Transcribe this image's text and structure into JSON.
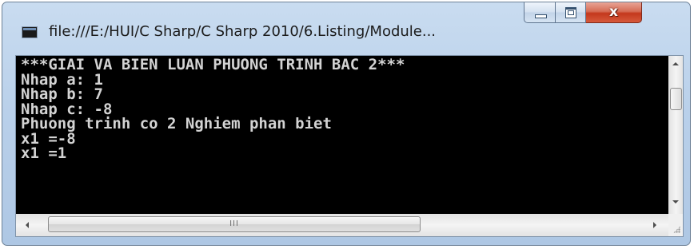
{
  "window": {
    "title": "file:///E:/HUI/C Sharp/C Sharp 2010/6.Listing/Module...",
    "close_glyph": "x"
  },
  "console": {
    "lines": [
      "***GIAI VA BIEN LUAN PHUONG TRINH BAC 2***",
      "Nhap a: 1",
      "Nhap b: 7",
      "Nhap c: -8",
      "Phuong trinh co 2 Nghiem phan biet",
      "x1 =-8",
      "x1 =1"
    ],
    "text_color": "#d3d3d3",
    "background": "#000000"
  },
  "scrollbars": {
    "horizontal_thumb_grip": "III",
    "icons": [
      "up-arrow-icon",
      "down-arrow-icon",
      "left-arrow-icon",
      "right-arrow-icon",
      "resize-grip-icon"
    ]
  },
  "colors": {
    "close_button": "#c4381d",
    "frame": "#b9d0ea"
  }
}
